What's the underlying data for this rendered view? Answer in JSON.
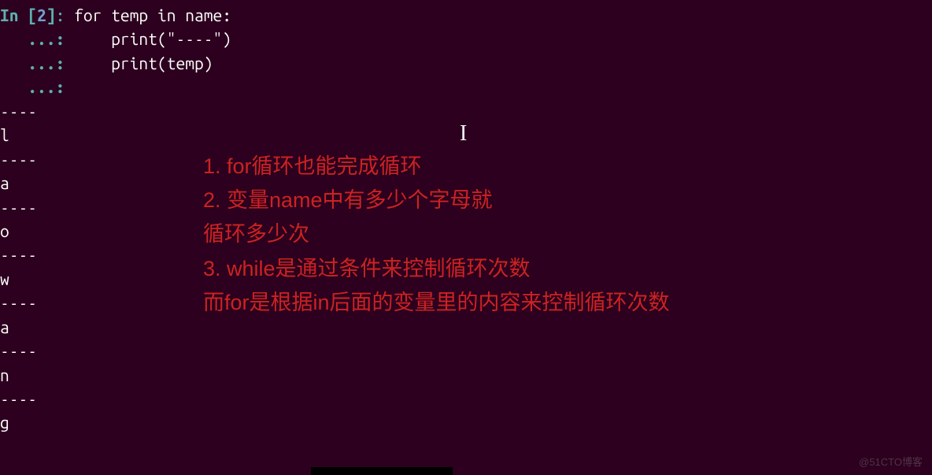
{
  "prompt": {
    "in_label": "In ",
    "bracket_open": "[",
    "number": "2",
    "bracket_close": "]",
    "colon": ": ",
    "continuation": "   ...: "
  },
  "code": {
    "line1": "for temp in name:",
    "line2": "    print(\"----\")",
    "line3": "    print(temp)",
    "line4": ""
  },
  "output": [
    "----",
    "l",
    "----",
    "a",
    "----",
    "o",
    "----",
    "w",
    "----",
    "a",
    "----",
    "n",
    "----",
    "g"
  ],
  "annotation": {
    "line1": "1. for循环也能完成循环",
    "line2": "2. 变量name中有多少个字母就",
    "line3": "    循环多少次",
    "line4": "3. while是通过条件来控制循环次数",
    "line5": "    而for是根据in后面的变量里的内容来控制循环次数"
  },
  "cursor": "I",
  "watermark": "@51CTO博客"
}
